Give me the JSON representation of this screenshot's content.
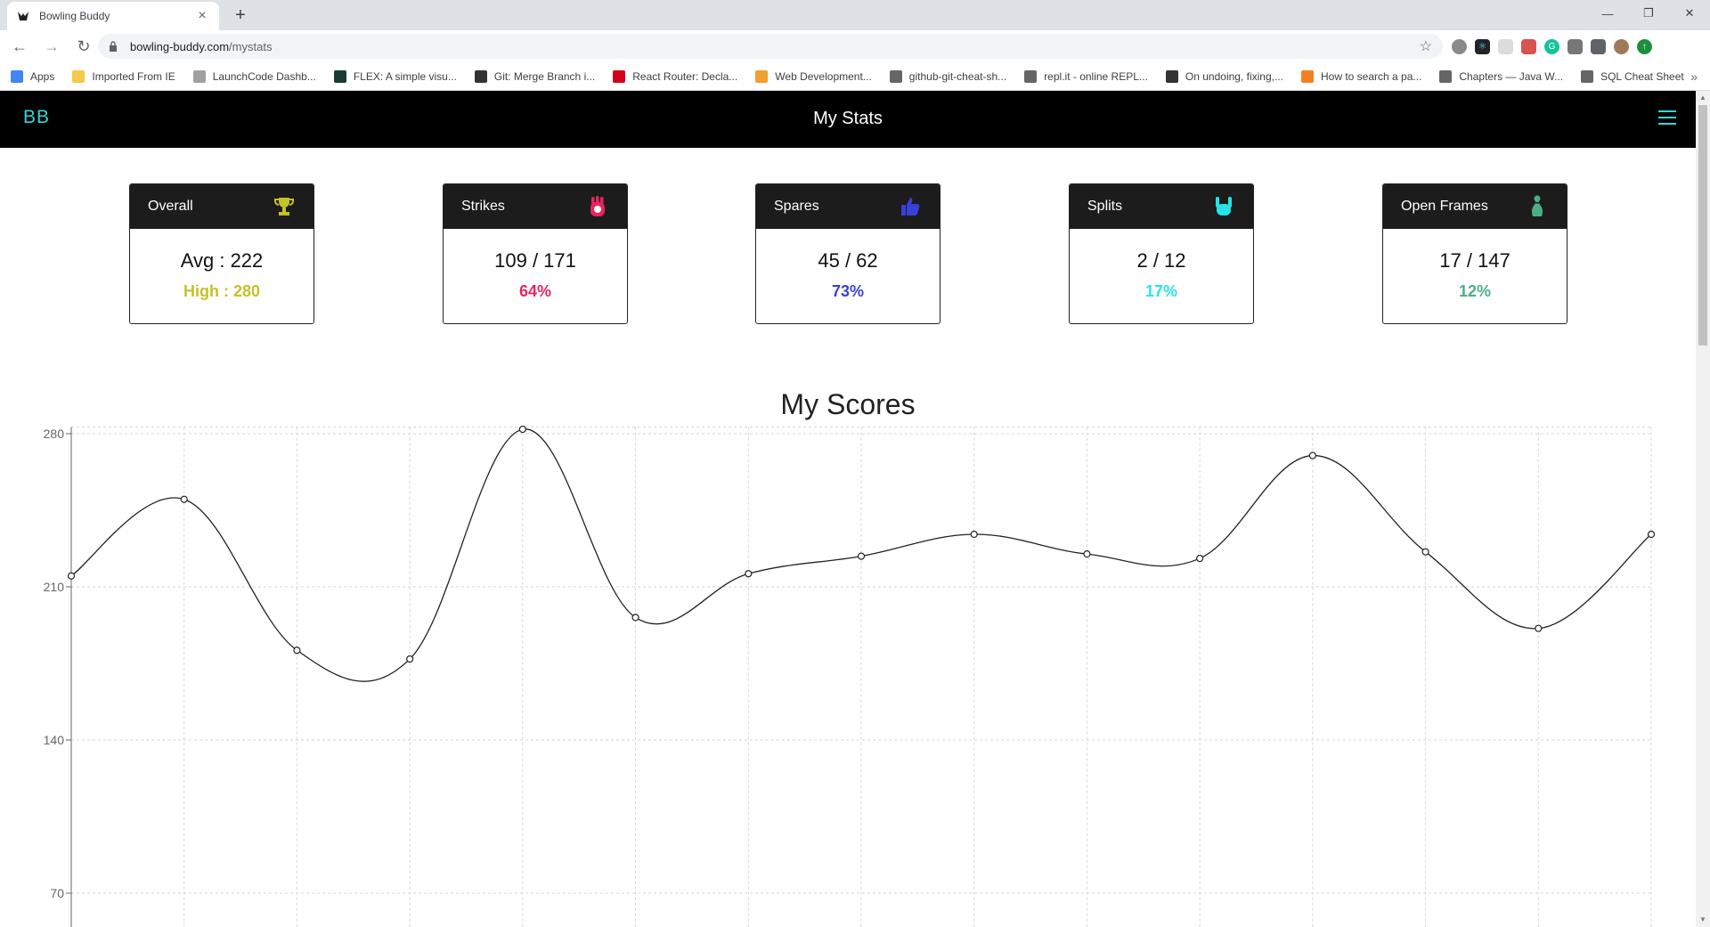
{
  "browser": {
    "tab_title": "Bowling Buddy",
    "url_host": "bowling-buddy.com",
    "url_path": "/mystats",
    "bookmarks": [
      {
        "label": "Apps",
        "color": "#4285f4"
      },
      {
        "label": "Imported From IE",
        "color": "#f6c94a"
      },
      {
        "label": "LaunchCode Dashb...",
        "color": "#a0a0a0"
      },
      {
        "label": "FLEX: A simple visu...",
        "color": "#1a3b34"
      },
      {
        "label": "Git: Merge Branch i...",
        "color": "#333333"
      },
      {
        "label": "React Router: Decla...",
        "color": "#d0021b"
      },
      {
        "label": "Web Development...",
        "color": "#f0a030"
      },
      {
        "label": "github-git-cheat-sh...",
        "color": "#666666"
      },
      {
        "label": "repl.it - online REPL...",
        "color": "#666666"
      },
      {
        "label": "On undoing, fixing,...",
        "color": "#333333"
      },
      {
        "label": "How to search a pa...",
        "color": "#f48024"
      },
      {
        "label": "Chapters — Java W...",
        "color": "#666666"
      },
      {
        "label": "SQL Cheat Sheet",
        "color": "#666666"
      }
    ]
  },
  "app": {
    "brand": "BB",
    "title": "My Stats",
    "accent": "#34d5d5"
  },
  "cards": [
    {
      "label": "Overall",
      "ratio": "Avg : 222",
      "pct": "High : 280",
      "color": "#c5c12a",
      "icon": "trophy-icon"
    },
    {
      "label": "Strikes",
      "ratio": "109 / 171",
      "pct": "64%",
      "color": "#e8245e",
      "icon": "fist-icon"
    },
    {
      "label": "Spares",
      "ratio": "45 / 62",
      "pct": "73%",
      "color": "#3a3fd9",
      "icon": "thumbs-up-icon"
    },
    {
      "label": "Splits",
      "ratio": "2 / 12",
      "pct": "17%",
      "color": "#27e3e8",
      "icon": "rock-on-icon"
    },
    {
      "label": "Open Frames",
      "ratio": "17 / 147",
      "pct": "12%",
      "color": "#4caf84",
      "icon": "bowling-pin-icon"
    }
  ],
  "chart_data": {
    "type": "line",
    "title": "My Scores",
    "xlabel": "",
    "ylabel": "",
    "yticks": [
      70,
      140,
      210,
      280
    ],
    "ylim": [
      56,
      283
    ],
    "grid": true,
    "values": [
      215,
      250,
      181,
      177,
      282,
      196,
      216,
      224,
      234,
      225,
      223,
      270,
      226,
      191,
      234
    ]
  }
}
